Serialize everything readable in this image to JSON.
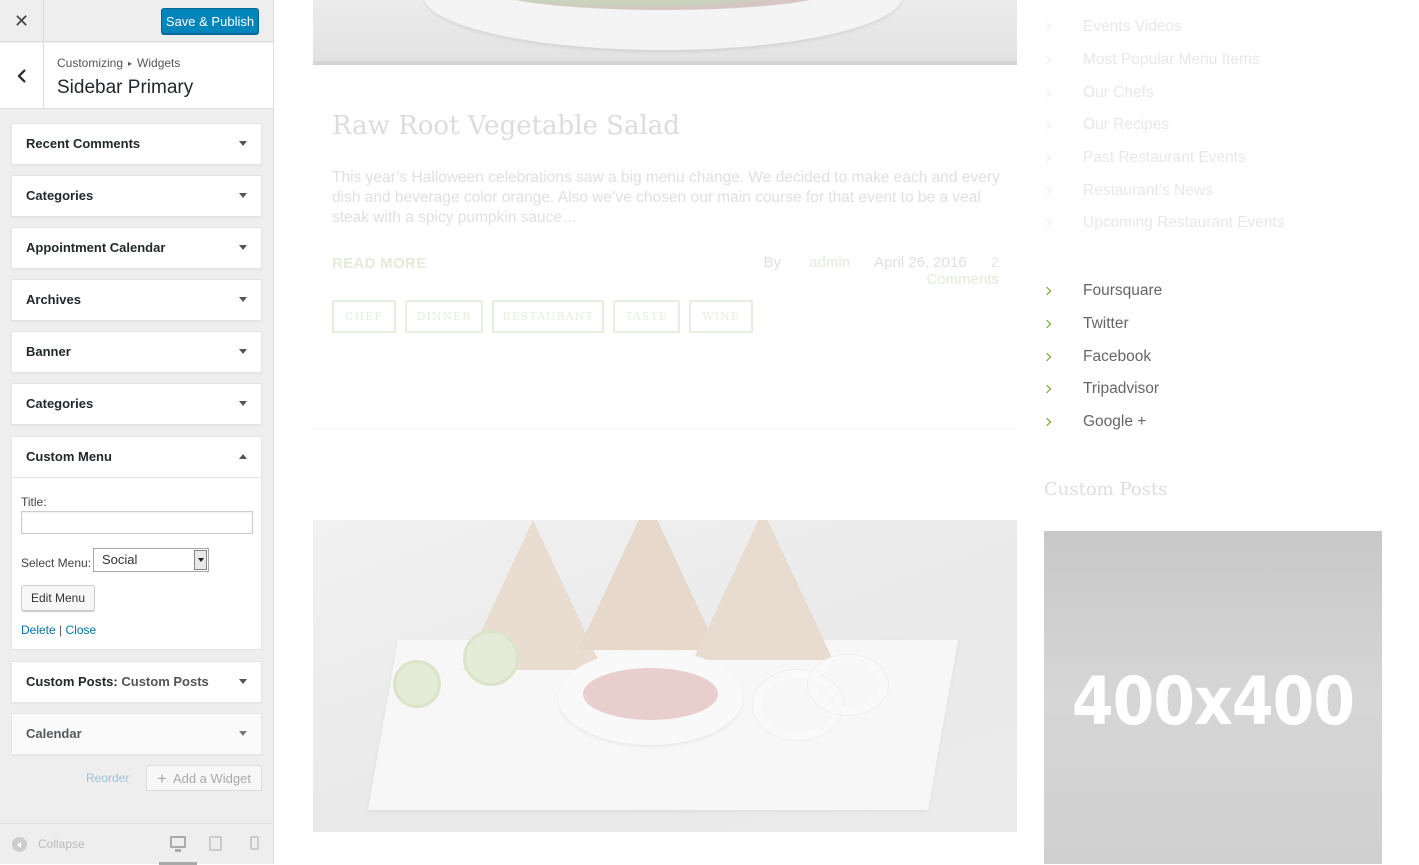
{
  "customizer": {
    "close_glyph": "✕",
    "save_label": "Save & Publish",
    "breadcrumb": {
      "root": "Customizing",
      "separator": "▸",
      "leaf": "Widgets"
    },
    "section_title": "Sidebar Primary",
    "widgets": [
      {
        "title": "Recent Comments"
      },
      {
        "title": "Categories"
      },
      {
        "title": "Appointment Calendar"
      },
      {
        "title": "Archives"
      },
      {
        "title": "Banner"
      },
      {
        "title": "Categories"
      }
    ],
    "open_widget": {
      "title": "Custom Menu",
      "title_field_label": "Title:",
      "title_field_value": "",
      "select_label": "Select Menu:",
      "select_value": "Social",
      "edit_button": "Edit Menu",
      "delete_link": "Delete",
      "link_separator": "|",
      "close_link": "Close"
    },
    "widgets_after": [
      {
        "title": "Custom Posts:",
        "subtitle": "Custom Posts"
      },
      {
        "title": "Calendar"
      }
    ],
    "reorder_label": "Reorder",
    "add_widget_label": "Add a Widget",
    "add_widget_glyph": "+",
    "collapse_label": "Collapse"
  },
  "preview": {
    "post": {
      "title": "Raw Root Vegetable Salad",
      "excerpt": "This year’s Halloween celebrations saw a big menu change. We decided to make each and every dish and beverage color orange. Also we’ve chosen our main course for that event to be a veal steak with a spicy pumpkin sauce…",
      "read_more": "READ MORE",
      "by_prefix": "By",
      "author": "admin",
      "date": "April 26, 2016",
      "comments": "2 Comments",
      "tags": [
        "CHEF",
        "DINNER",
        "RESTAURANT",
        "TASTE",
        "WINE"
      ]
    },
    "categories_list": [
      "Events Videos",
      "Most Popular Menu Items",
      "Our Chefs",
      "Our Recipes",
      "Past Restaurant Events",
      "Restaurant’s News",
      "Upcoming Restaurant Events"
    ],
    "social_list": [
      "Foursquare",
      "Twitter",
      "Facebook",
      "Tripadvisor",
      "Google +"
    ],
    "custom_posts_title": "Custom Posts",
    "placeholder_text": "400x400"
  }
}
